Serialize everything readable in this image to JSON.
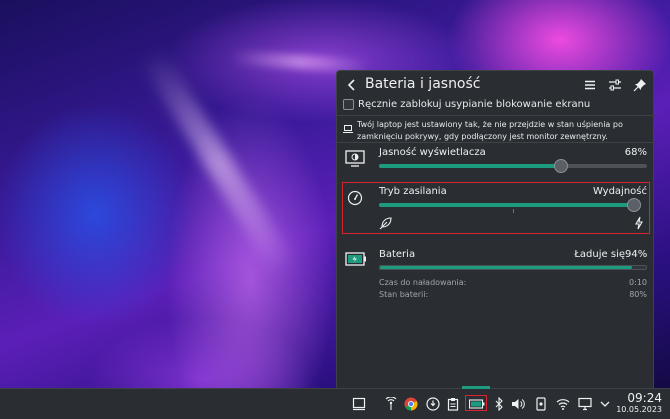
{
  "popup": {
    "title": "Bateria i jasność",
    "inhibit_label": "Ręcznie zablokuj usypianie blokowanie ekranu",
    "inhibit_checked": false,
    "info_text": "Twój laptop jest ustawiony tak, że nie przejdzie w stan uśpienia po zamknięciu pokrywy, gdy podłączony jest monitor zewnętrzny.",
    "brightness": {
      "label": "Jasność wyświetlacza",
      "value": "68%",
      "level": 0.68
    },
    "power_mode": {
      "label": "Tryb zasilania",
      "value": "Wydajność",
      "level": 1.0
    },
    "battery": {
      "label": "Bateria",
      "status": "Ładuje się",
      "percent": "94%",
      "level": 0.94,
      "details": [
        {
          "label": "Czas do naładowania:",
          "value": "0:10"
        },
        {
          "label": "Stan baterii:",
          "value": "80%"
        }
      ]
    }
  },
  "header_icons": [
    "back-icon",
    "menu-icon",
    "configure-icon",
    "pin-icon"
  ],
  "taskbar": {
    "clock_time": "09:24",
    "clock_date": "10.05.2023",
    "tray_icons": [
      "show-desktop-icon",
      "network-monitor-icon",
      "chrome-icon",
      "updates-icon",
      "clipboard-icon",
      "battery-icon",
      "bluetooth-icon",
      "volume-icon",
      "device-icon",
      "wifi-icon",
      "display-icon",
      "expand-tray-icon"
    ]
  },
  "colors": {
    "accent": "#1d9b7e",
    "highlight": "#d8242e",
    "panel": "#2a2e32"
  }
}
